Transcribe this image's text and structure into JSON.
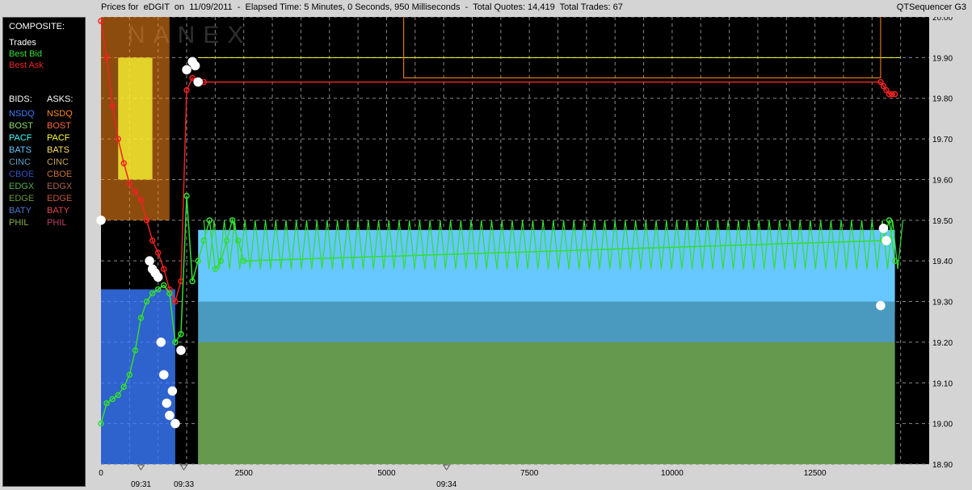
{
  "window": {
    "title": "Prices for  eDGIT  on  11/09/2011  -  Elapsed Time: 5 Minutes, 0 Seconds, 950 Milliseconds  -  Total Quotes: 14,419  Total Trades: 67",
    "brand": "QTSequencer G3",
    "watermark": "NANEX"
  },
  "legend": {
    "composite_header": "COMPOSITE:",
    "composite": [
      {
        "label": "Trades",
        "color": "#ffffff"
      },
      {
        "label": "Best Bid",
        "color": "#33dd33"
      },
      {
        "label": "Best Ask",
        "color": "#ee2222"
      }
    ],
    "bids_header": "BIDS:",
    "asks_header": "ASKS:",
    "exchanges": [
      {
        "bid": "NSDQ",
        "ask": "NSDQ",
        "bid_color": "#3a7bff",
        "ask_color": "#ff8a1a"
      },
      {
        "bid": "BOST",
        "ask": "BOST",
        "bid_color": "#8fdc6a",
        "ask_color": "#ff6a3a"
      },
      {
        "bid": "PACF",
        "ask": "PACF",
        "bid_color": "#40ffff",
        "ask_color": "#ffff33"
      },
      {
        "bid": "BATS",
        "ask": "BATS",
        "bid_color": "#66c8ff",
        "ask_color": "#ffe066"
      },
      {
        "bid": "CINC",
        "ask": "CINC",
        "bid_color": "#5aa0c8",
        "ask_color": "#c8a050"
      },
      {
        "bid": "CBOE",
        "ask": "CBOE",
        "bid_color": "#3050c0",
        "ask_color": "#c87030"
      },
      {
        "bid": "EDGX",
        "ask": "EDGX",
        "bid_color": "#50b050",
        "ask_color": "#b06050"
      },
      {
        "bid": "EDGE",
        "ask": "EDGE",
        "bid_color": "#6a9a3a",
        "ask_color": "#c05a3a"
      },
      {
        "bid": "BATY",
        "ask": "BATY",
        "bid_color": "#4a7ad0",
        "ask_color": "#e04a4a"
      },
      {
        "bid": "PHIL",
        "ask": "PHIL",
        "bid_color": "#8ab040",
        "ask_color": "#c03a6a"
      }
    ]
  },
  "chart_data": {
    "type": "line",
    "xlim": [
      0,
      14500
    ],
    "ylim": [
      18.9,
      20.0
    ],
    "x_ticks": [
      0,
      2500,
      5000,
      7500,
      10000,
      12500
    ],
    "x_tick_labels": [
      "0",
      "2500",
      "5000",
      "7500",
      "10000",
      "12500"
    ],
    "y_ticks": [
      18.9,
      19.0,
      19.1,
      19.2,
      19.3,
      19.4,
      19.5,
      19.6,
      19.7,
      19.8,
      19.9,
      20.0
    ],
    "y_tick_labels": [
      "18.90",
      "19.00",
      "19.10",
      "19.20",
      "19.30",
      "19.40",
      "19.50",
      "19.60",
      "19.70",
      "19.80",
      "19.90",
      "20.00"
    ],
    "time_markers": [
      {
        "x": 700,
        "label": "09:31"
      },
      {
        "x": 1450,
        "label": "09:33"
      },
      {
        "x": 6050,
        "label": "09:34"
      }
    ],
    "grid": true,
    "background": "#000000",
    "grid_color": "#8a8a8a",
    "series": [
      {
        "name": "Best Ask",
        "color": "#ee2222",
        "x": [
          0,
          100,
          200,
          300,
          400,
          500,
          600,
          700,
          800,
          900,
          1000,
          1100,
          1200,
          1300,
          1400,
          1500,
          1600,
          1700,
          1800,
          13650,
          13700,
          13750,
          13800,
          13850,
          13900
        ],
        "y": [
          19.99,
          19.9,
          19.78,
          19.7,
          19.64,
          19.59,
          19.57,
          19.55,
          19.5,
          19.45,
          19.42,
          19.38,
          19.33,
          19.3,
          19.35,
          19.82,
          19.85,
          19.84,
          19.84,
          19.84,
          19.83,
          19.82,
          19.81,
          19.81,
          19.81
        ]
      },
      {
        "name": "Best Bid",
        "color": "#33dd33",
        "x": [
          0,
          100,
          200,
          300,
          400,
          500,
          600,
          700,
          800,
          900,
          1000,
          1100,
          1200,
          1300,
          1400,
          1500,
          1600,
          1700,
          1800,
          1900,
          2000,
          2100,
          2200,
          2300,
          2400,
          2500,
          13700,
          13800,
          13900
        ],
        "y": [
          19.0,
          19.05,
          19.06,
          19.07,
          19.09,
          19.12,
          19.18,
          19.26,
          19.3,
          19.32,
          19.33,
          19.34,
          19.32,
          19.2,
          19.22,
          19.56,
          19.35,
          19.4,
          19.45,
          19.5,
          19.38,
          19.4,
          19.45,
          19.5,
          19.45,
          19.4,
          19.45,
          19.5,
          19.4
        ]
      },
      {
        "name": "Trades",
        "color": "#ffffff",
        "x": [
          0,
          850,
          900,
          950,
          1000,
          1050,
          1100,
          1150,
          1200,
          1250,
          1300,
          1400,
          1500,
          1600,
          1650,
          1700,
          13650,
          13700,
          13750
        ],
        "y": [
          19.5,
          19.4,
          19.38,
          19.37,
          19.36,
          19.2,
          19.12,
          19.05,
          19.02,
          19.08,
          19.0,
          19.18,
          19.87,
          19.89,
          19.88,
          19.84,
          19.29,
          19.48,
          19.45
        ]
      }
    ]
  }
}
